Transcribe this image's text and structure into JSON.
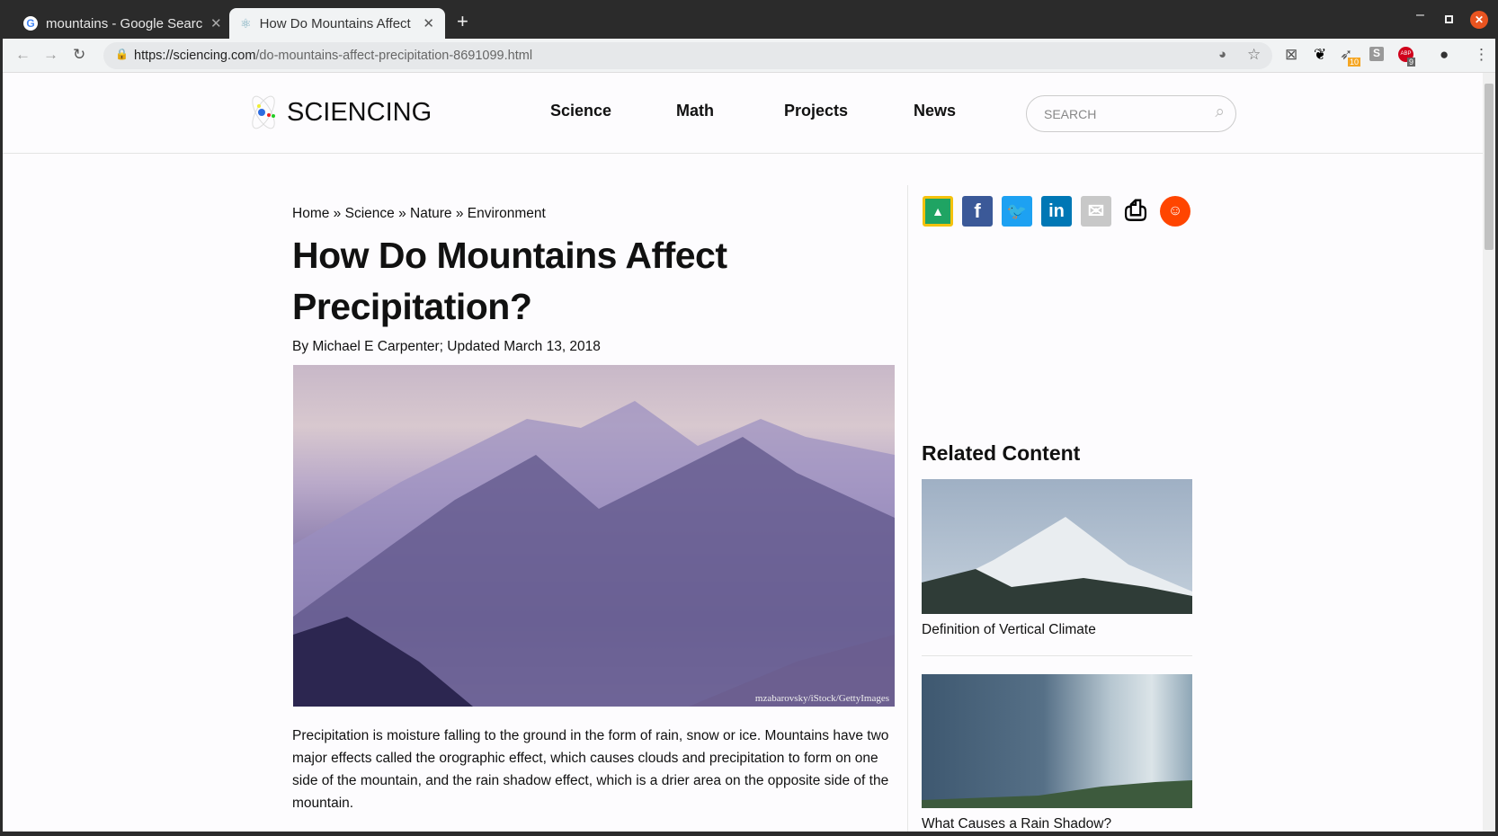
{
  "browser": {
    "tabs": [
      {
        "title": "mountains - Google Search",
        "active": false
      },
      {
        "title": "How Do Mountains Affect Precipitation?",
        "active": true
      }
    ],
    "new_tab": "+",
    "url_domain": "https://sciencing.com",
    "url_path": "/do-mountains-affect-precipitation-8691099.html",
    "extension_badges": [
      "10",
      "9"
    ]
  },
  "site": {
    "logo": "SCIENCING",
    "nav": [
      "Science",
      "Math",
      "Projects",
      "News"
    ],
    "search_placeholder": "SEARCH"
  },
  "article": {
    "breadcrumb": [
      "Home",
      "Science",
      "Nature",
      "Environment"
    ],
    "breadcrumb_sep": "»",
    "title": "How Do Mountains Affect Precipitation?",
    "byline": "By Michael E Carpenter; Updated March 13, 2018",
    "image_credit": "mzabarovsky/iStock/GettyImages",
    "paragraph": "Precipitation is moisture falling to the ground in the form of rain, snow or ice. Mountains have two major effects called the orographic effect, which causes clouds and precipitation to form on one side of the mountain, and the rain shadow effect, which is a drier area on the opposite side of the mountain."
  },
  "share_icons": [
    "google-classroom",
    "facebook",
    "twitter",
    "linkedin",
    "email",
    "print",
    "reddit"
  ],
  "related": {
    "heading": "Related Content",
    "items": [
      {
        "title": "Definition of Vertical Climate"
      },
      {
        "title": "What Causes a Rain Shadow?"
      }
    ]
  },
  "colors": {
    "facebook": "#3b5998",
    "twitter": "#1da1f2",
    "linkedin": "#0077b5",
    "reddit": "#ff4500",
    "classroom": "#1fa463",
    "close": "#e95420"
  }
}
